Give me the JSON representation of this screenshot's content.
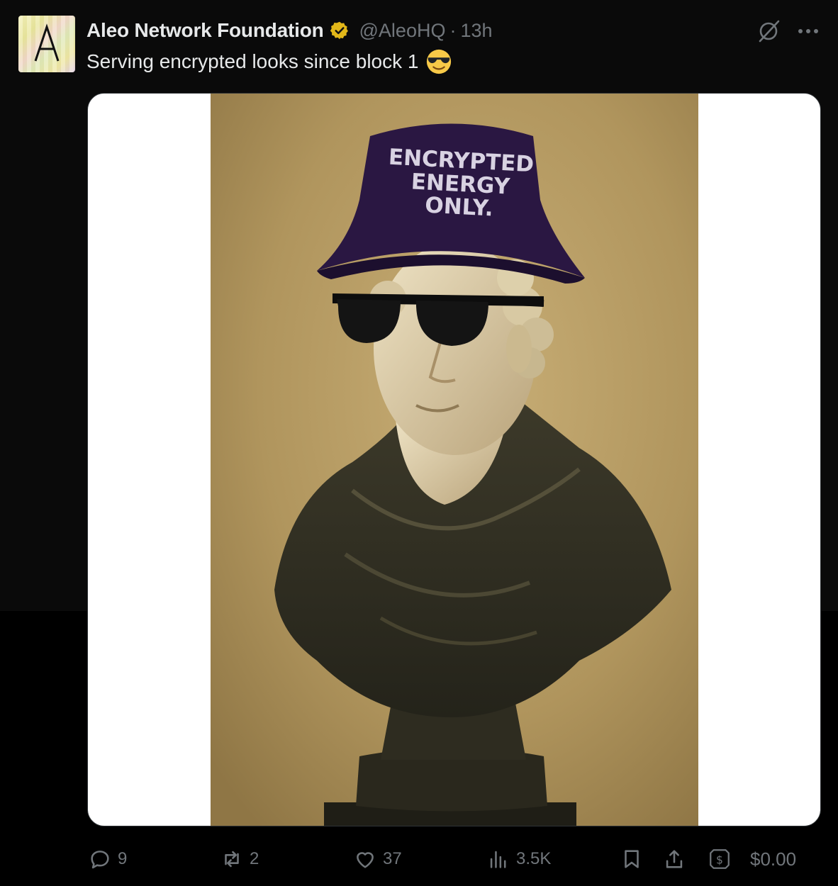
{
  "tweet": {
    "display_name": "Aleo Network Foundation",
    "handle": "@AleoHQ",
    "separator": "·",
    "time": "13h",
    "text": "Serving encrypted looks since block 1",
    "avatar_letter": "A",
    "verified_color": "#e2b719"
  },
  "media": {
    "hat_text": [
      "ENCRYPTED",
      "ENERGY",
      "ONLY."
    ],
    "hat_color": "#2a1742",
    "background_color": "#b59a62"
  },
  "actions": {
    "replies": "9",
    "reposts": "2",
    "likes": "37",
    "views": "3.5K",
    "tip_amount": "$0.00"
  },
  "icons": {
    "reply": "reply-icon",
    "repost": "repost-icon",
    "like": "heart-icon",
    "views": "views-icon",
    "bookmark": "bookmark-icon",
    "share": "share-icon",
    "tip": "tip-dollar-icon",
    "grok": "grok-icon",
    "more": "more-icon"
  }
}
